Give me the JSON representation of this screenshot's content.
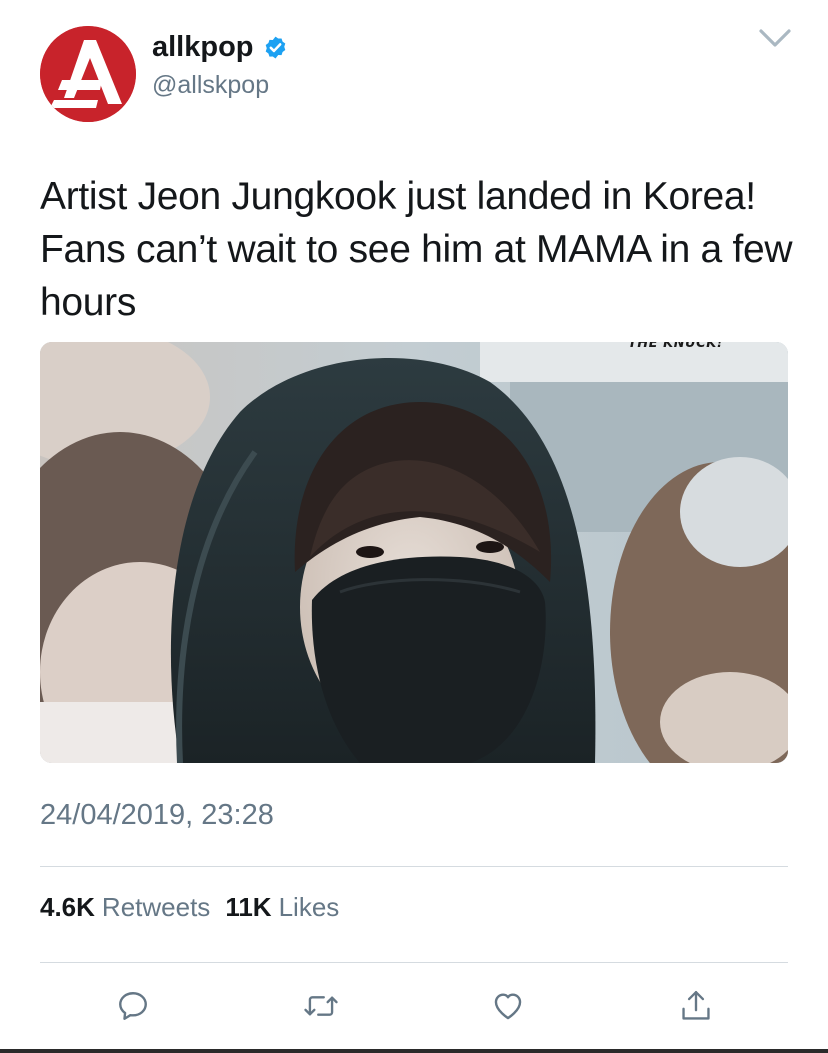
{
  "tweet": {
    "author": {
      "display_name": "allkpop",
      "handle": "@allskpop",
      "verified": true,
      "avatar_color": "#c8232b"
    },
    "text": "Artist Jeon Jungkook just landed in Korea! Fans can’t wait to see him at MAMA in a few hours",
    "media": {
      "watermark": "THE KNUCK!"
    },
    "timestamp": "24/04/2019, 23:28",
    "stats": {
      "retweets_count": "4.6K",
      "retweets_label": "Retweets",
      "likes_count": "11K",
      "likes_label": "Likes"
    }
  },
  "colors": {
    "primary_text": "#14171a",
    "secondary_text": "#657786",
    "verified_blue": "#1da1f2",
    "divider": "#d5dbe0"
  },
  "icons": {
    "menu": "chevron-down-icon",
    "reply": "reply-icon",
    "retweet": "retweet-icon",
    "like": "heart-icon",
    "share": "share-icon"
  }
}
